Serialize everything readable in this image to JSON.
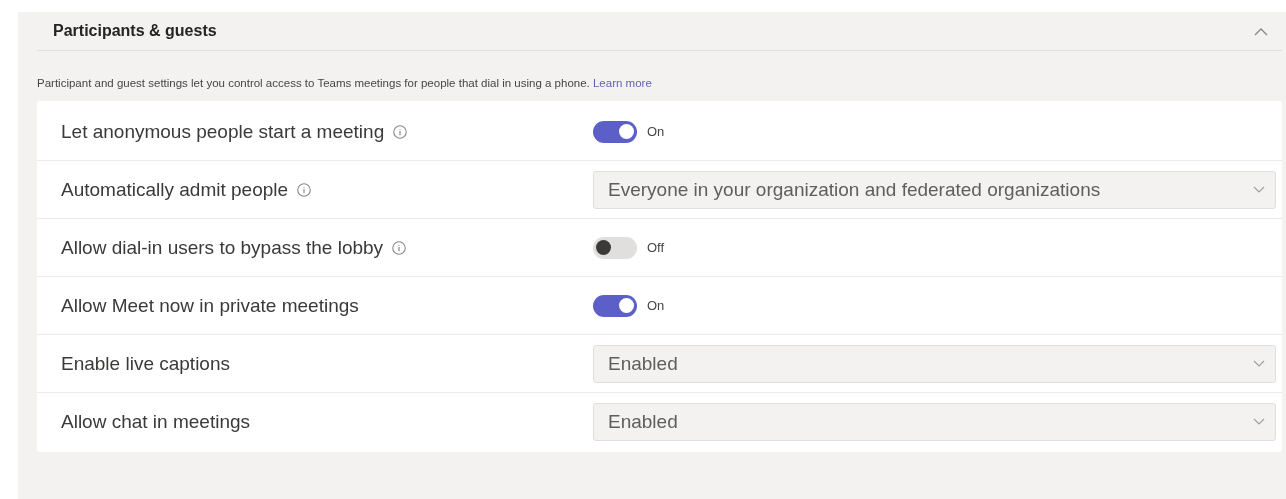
{
  "section": {
    "title": "Participants & guests",
    "expanded": true,
    "description": "Participant and guest settings let you control access to Teams meetings for people that dial in using a phone.",
    "link": "Learn more"
  },
  "settings": [
    {
      "label": "Let anonymous people start a meeting",
      "info": true,
      "kind": "toggle",
      "on": true,
      "state_text": "On"
    },
    {
      "label": "Automatically admit people",
      "info": true,
      "kind": "select",
      "value": "Everyone in your organization and federated organizations"
    },
    {
      "label": "Allow dial-in users to bypass the lobby",
      "info": true,
      "kind": "toggle",
      "on": false,
      "state_text": "Off"
    },
    {
      "label": "Allow Meet now in private meetings",
      "info": false,
      "kind": "toggle",
      "on": true,
      "state_text": "On"
    },
    {
      "label": "Enable live captions",
      "info": false,
      "kind": "select",
      "value": "Enabled"
    },
    {
      "label": "Allow chat in meetings",
      "info": false,
      "kind": "select",
      "value": "Enabled"
    }
  ]
}
